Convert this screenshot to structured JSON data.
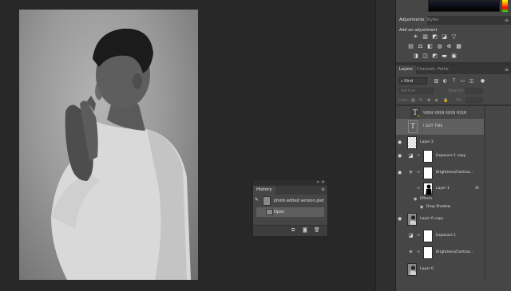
{
  "history_panel": {
    "tab_label": "History",
    "snapshot_name": "photo edited version.psd",
    "steps": [
      "Open"
    ]
  },
  "right_dock": {
    "adjust_tabs": [
      "Adjustments",
      "Styles"
    ],
    "add_adjustment_label": "Add an adjustment",
    "layer_tabs": [
      "Layers",
      "Channels",
      "Paths"
    ],
    "filter_kind": "Kind",
    "blend_mode": "Normal",
    "opacity_label": "Opacity:",
    "lock_label": "Lock:",
    "fill_label": "Fill:",
    "effects_label": "Effects",
    "drop_shadow_label": "Drop Shadow",
    "layers": [
      {
        "name": "빅피쳐 빅피쳐 빅피쳐 빅피쳐",
        "type": "text-warn",
        "visible": false
      },
      {
        "name": "I GOT THIS",
        "type": "text",
        "visible": false,
        "selected": true
      },
      {
        "name": "Layer 2",
        "type": "checker",
        "visible": true
      },
      {
        "name": "Exposure 1 copy",
        "type": "adjustment-exposure",
        "visible": true
      },
      {
        "name": "Brightness/Contras...",
        "type": "adjustment-brightness",
        "visible": true
      },
      {
        "name": "Layer 1",
        "type": "masked",
        "visible": false,
        "fx": "fx"
      },
      {
        "name": "Layer 0 copy",
        "type": "photo",
        "visible": true
      },
      {
        "name": "Exposure 1",
        "type": "adjustment-exposure",
        "visible": false
      },
      {
        "name": "Brightness/Contras...",
        "type": "adjustment-brightness",
        "visible": false
      },
      {
        "name": "Layer 0",
        "type": "photo",
        "visible": false
      }
    ]
  },
  "colors": {
    "canvas_bg": "#282828",
    "panel_bg": "#464646",
    "selected_row": "#5f5f5f"
  }
}
